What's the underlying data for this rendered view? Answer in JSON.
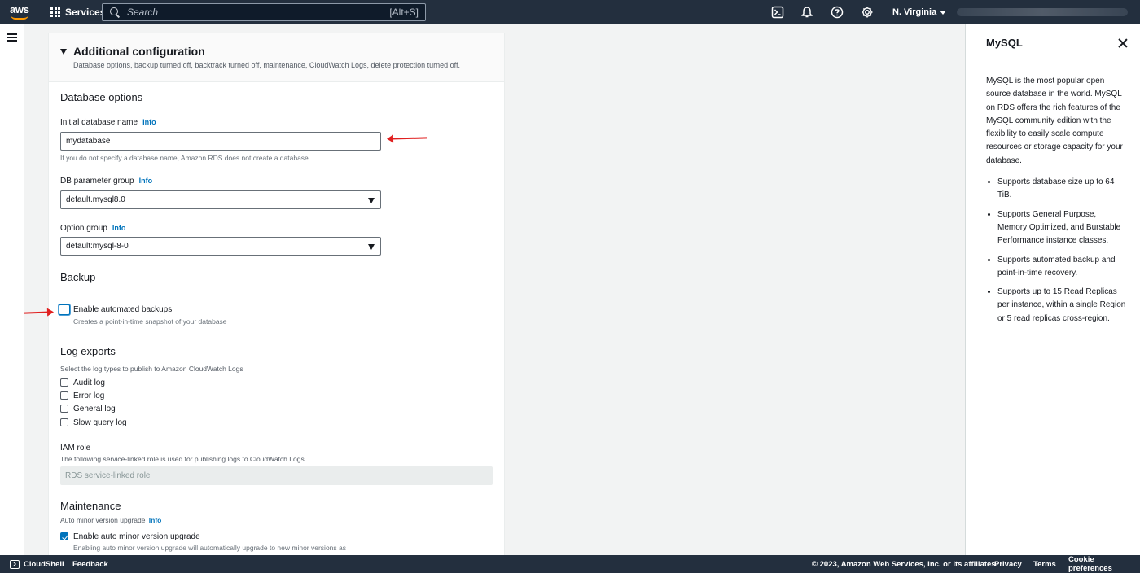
{
  "topnav": {
    "logo_text": "aws",
    "services_label": "Services",
    "search_placeholder": "Search",
    "search_shortcut": "[Alt+S]",
    "region": "N. Virginia",
    "icons": [
      "cloudshell-icon",
      "bell-icon",
      "help-icon",
      "gear-icon"
    ]
  },
  "section": {
    "title": "Additional configuration",
    "description": "Database options, backup turned off, backtrack turned off, maintenance, CloudWatch Logs, delete protection turned off."
  },
  "database_options": {
    "heading": "Database options",
    "db_name_label": "Initial database name",
    "db_name_info": "Info",
    "db_name_value": "mydatabase",
    "db_name_hint": "If you do not specify a database name, Amazon RDS does not create a database.",
    "param_group_label": "DB parameter group",
    "param_group_info": "Info",
    "param_group_value": "default.mysql8.0",
    "option_group_label": "Option group",
    "option_group_info": "Info",
    "option_group_value": "default:mysql-8-0"
  },
  "backup": {
    "heading": "Backup",
    "enable_label": "Enable automated backups",
    "enable_hint": "Creates a point-in-time snapshot of your database",
    "enabled": false
  },
  "log_exports": {
    "heading": "Log exports",
    "hint": "Select the log types to publish to Amazon CloudWatch Logs",
    "items": [
      {
        "label": "Audit log",
        "checked": false
      },
      {
        "label": "Error log",
        "checked": false
      },
      {
        "label": "General log",
        "checked": false
      },
      {
        "label": "Slow query log",
        "checked": false
      }
    ]
  },
  "iam": {
    "label": "IAM role",
    "hint": "The following service-linked role is used for publishing logs to CloudWatch Logs.",
    "value": "RDS service-linked role"
  },
  "maintenance": {
    "heading": "Maintenance",
    "sub_label": "Auto minor version upgrade",
    "sub_info": "Info",
    "enable_label": "Enable auto minor version upgrade",
    "enable_hint": "Enabling auto minor version upgrade will automatically upgrade to new minor versions as",
    "enabled": true
  },
  "help_panel": {
    "title": "MySQL",
    "intro": "MySQL is the most popular open source database in the world. MySQL on RDS offers the rich features of the MySQL community edition with the flexibility to easily scale compute resources or storage capacity for your database.",
    "bullets": [
      "Supports database size up to 64 TiB.",
      "Supports General Purpose, Memory Optimized, and Burstable Performance instance classes.",
      "Supports automated backup and point-in-time recovery.",
      "Supports up to 15 Read Replicas per instance, within a single Region or 5 read replicas cross-region."
    ]
  },
  "footer": {
    "cloudshell": "CloudShell",
    "feedback": "Feedback",
    "copyright": "© 2023, Amazon Web Services, Inc. or its affiliates.",
    "privacy": "Privacy",
    "terms": "Terms",
    "cookies": "Cookie preferences"
  },
  "colors": {
    "nav_bg": "#232f3e",
    "link": "#0073bb",
    "accent": "#ff9900",
    "annotation_arrow": "#e02020"
  }
}
